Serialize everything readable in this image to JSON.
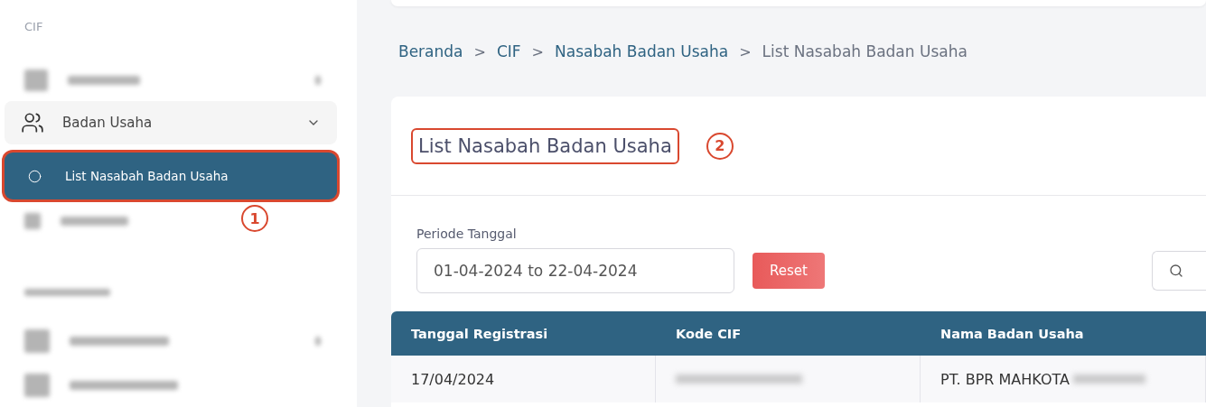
{
  "sidebar": {
    "section": "CIF",
    "items": [
      {
        "label": "Badan Usaha",
        "expanded": true,
        "children": [
          {
            "label": "List Nasabah Badan Usaha",
            "selected": true,
            "callout": "1"
          }
        ]
      }
    ]
  },
  "breadcrumb": [
    {
      "label": "Beranda",
      "link": true
    },
    {
      "label": "CIF",
      "link": true
    },
    {
      "label": "Nasabah Badan Usaha",
      "link": true
    },
    {
      "label": "List Nasabah Badan Usaha",
      "link": false
    }
  ],
  "breadcrumb_separator": ">",
  "page_title": {
    "text": "List Nasabah Badan Usaha",
    "callout": "2"
  },
  "filter": {
    "label": "Periode Tanggal",
    "value": "01-04-2024 to 22-04-2024",
    "reset_button": "Reset"
  },
  "table": {
    "columns": [
      "Tanggal Registrasi",
      "Kode CIF",
      "Nama Badan Usaha"
    ],
    "rows": [
      [
        "17/04/2024",
        "",
        "PT. BPR MAHKOTA"
      ]
    ]
  }
}
